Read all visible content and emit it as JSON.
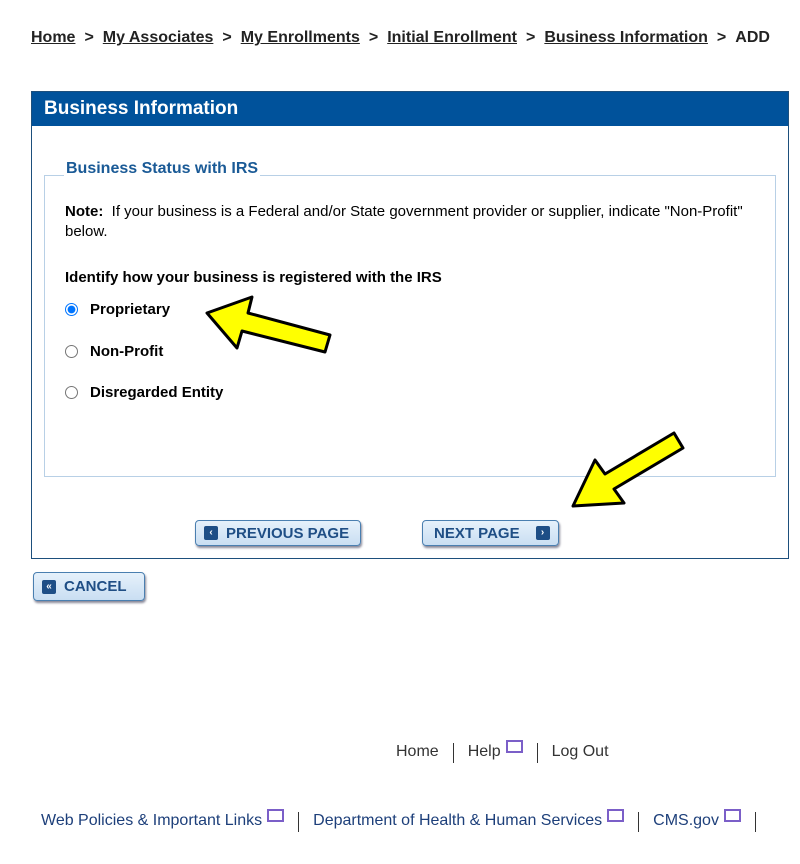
{
  "breadcrumb": {
    "items": [
      "Home",
      "My Associates",
      "My Enrollments",
      "Initial Enrollment",
      "Business Information"
    ],
    "current": "ADD",
    "separator": ">"
  },
  "panel": {
    "title": "Business Information",
    "section": {
      "legend": "Business Status with IRS",
      "note_label": "Note:",
      "note_text": "If your business is a Federal and/or State government provider or supplier, indicate \"Non-Profit\" below.",
      "question": "Identify how your business is registered with the IRS",
      "options": [
        {
          "label": "Proprietary",
          "selected": true
        },
        {
          "label": "Non-Profit",
          "selected": false
        },
        {
          "label": "Disregarded Entity",
          "selected": false
        }
      ]
    },
    "previous_label": "PREVIOUS PAGE",
    "next_label": "NEXT PAGE"
  },
  "cancel_label": "CANCEL",
  "footer": {
    "links": [
      "Home",
      "Help",
      "Log Out"
    ],
    "bottom_links": [
      "Web Policies & Important Links",
      "Department of Health & Human Services",
      "CMS.gov"
    ]
  },
  "colors": {
    "header": "#00529b",
    "legend": "#1a5a96",
    "arrow": "#ffff00"
  }
}
